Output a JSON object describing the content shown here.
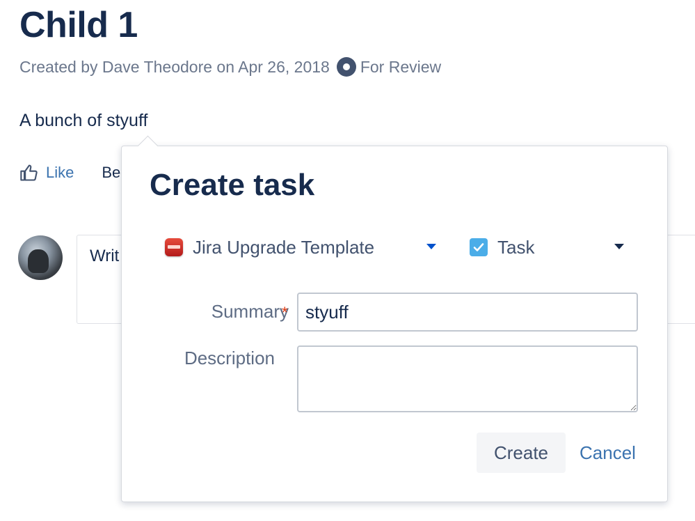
{
  "page": {
    "title": "Child 1",
    "byline": "Created by Dave Theodore on Apr 26, 2018",
    "status": "For Review",
    "body_text": "A bunch of styuff",
    "like_label": "Like",
    "be_first_text": "Be",
    "comment_placeholder": "Writ"
  },
  "dialog": {
    "title": "Create task",
    "project": {
      "selected": "Jira Upgrade Template",
      "icon": "project-avatar-icon"
    },
    "issue_type": {
      "selected": "Task",
      "icon": "task-checkbox-icon"
    },
    "fields": {
      "summary_label": "Summary",
      "summary_required_mark": "*",
      "summary_value": "styuff",
      "description_label": "Description",
      "description_value": ""
    },
    "buttons": {
      "create_label": "Create",
      "cancel_label": "Cancel"
    }
  },
  "colors": {
    "text_primary": "#172b4d",
    "text_secondary": "#6b778c",
    "link": "#3b73af",
    "required": "#de350b",
    "task_icon": "#4bade8",
    "caret_blue": "#0052cc"
  }
}
